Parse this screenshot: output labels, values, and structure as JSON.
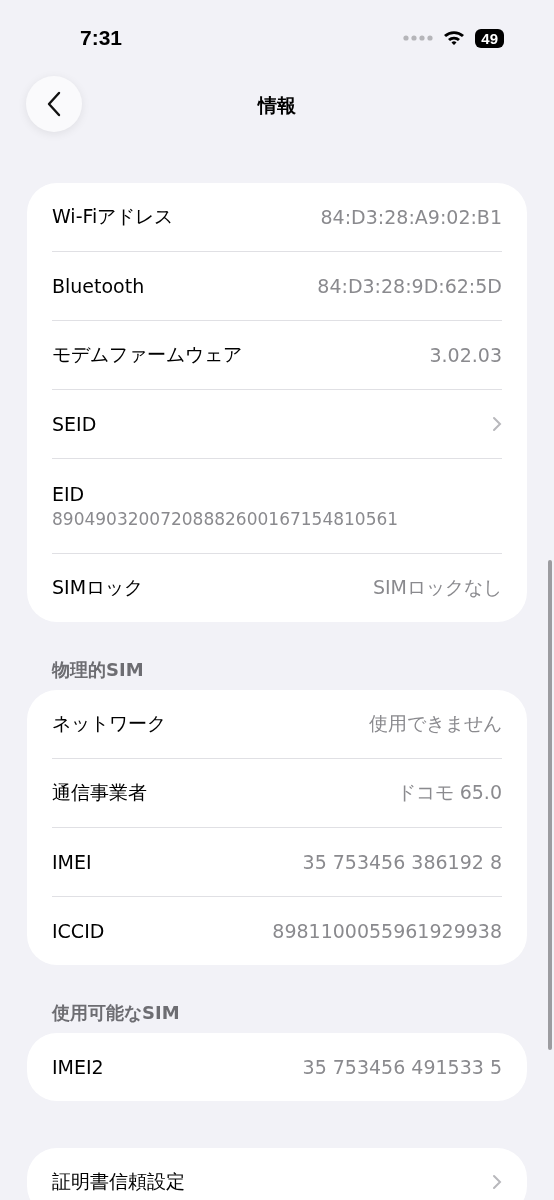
{
  "status_bar": {
    "time": "7:31",
    "battery": "49"
  },
  "nav": {
    "title": "情報"
  },
  "groups": [
    {
      "rows": [
        {
          "kind": "value",
          "label": "Wi-Fiアドレス",
          "value": "84:D3:28:A9:02:B1"
        },
        {
          "kind": "value",
          "label": "Bluetooth",
          "value": "84:D3:28:9D:62:5D"
        },
        {
          "kind": "value",
          "label": "モデムファームウェア",
          "value": "3.02.03"
        },
        {
          "kind": "chevron",
          "label": "SEID"
        },
        {
          "kind": "stacked",
          "label": "EID",
          "value": "89049032007208882600167154810561"
        },
        {
          "kind": "value",
          "label": "SIMロック",
          "value": "SIMロックなし"
        }
      ]
    },
    {
      "header": "物理的SIM",
      "rows": [
        {
          "kind": "value",
          "label": "ネットワーク",
          "value": "使用できません"
        },
        {
          "kind": "value",
          "label": "通信事業者",
          "value": "ドコモ 65.0"
        },
        {
          "kind": "value",
          "label": "IMEI",
          "value": "35 753456 386192 8"
        },
        {
          "kind": "value",
          "label": "ICCID",
          "value": "8981100055961929938"
        }
      ]
    },
    {
      "header": "使用可能なSIM",
      "rows": [
        {
          "kind": "value",
          "label": "IMEI2",
          "value": "35 753456 491533 5"
        }
      ]
    },
    {
      "rows": [
        {
          "kind": "chevron",
          "label": "証明書信頼設定"
        }
      ]
    }
  ]
}
